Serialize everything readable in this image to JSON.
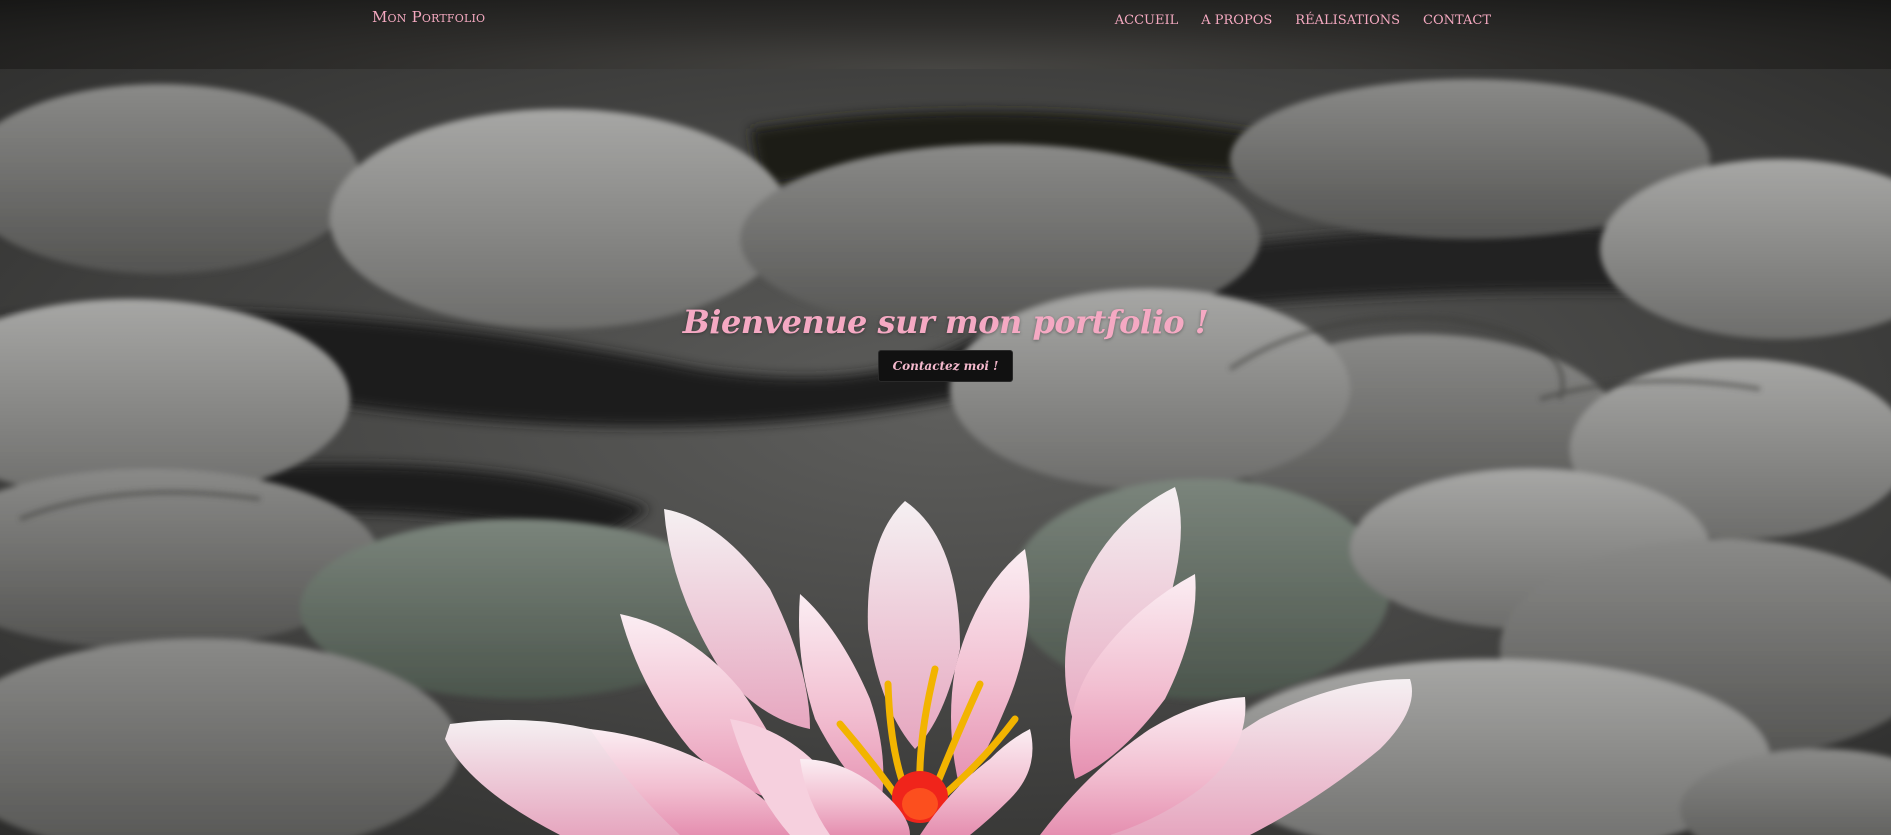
{
  "navbar": {
    "brand": "Mon Portfolio",
    "items": [
      {
        "label": "ACCUEIL"
      },
      {
        "label": "A PROPOS"
      },
      {
        "label": "RÉALISATIONS"
      },
      {
        "label": "CONTACT"
      }
    ]
  },
  "hero": {
    "title": "Bienvenue sur mon portfolio !",
    "cta_label": "Contactez moi !",
    "background_image": "water-lily-on-lily-pads"
  },
  "colors": {
    "accent_pink": "#f4a9c0",
    "navbar_dark": "#2e2d2b",
    "button_dark": "#111111"
  }
}
